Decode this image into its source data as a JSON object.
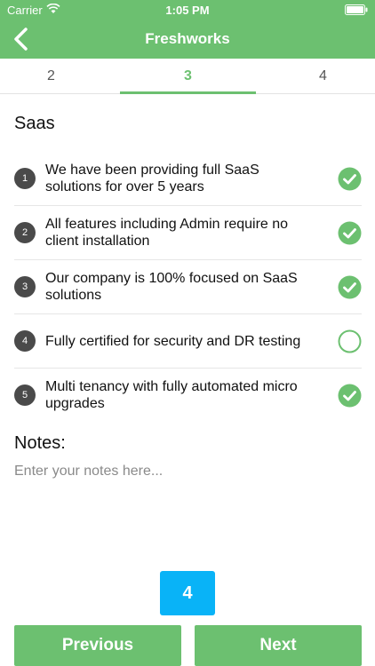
{
  "status_bar": {
    "carrier": "Carrier",
    "time": "1:05 PM"
  },
  "nav": {
    "title": "Freshworks",
    "back_icon": "chevron-left-icon"
  },
  "tabs": [
    {
      "label": "2",
      "active": false
    },
    {
      "label": "3",
      "active": true
    },
    {
      "label": "4",
      "active": false
    }
  ],
  "section": {
    "title": "Saas"
  },
  "checklist": [
    {
      "number": "1",
      "text": "We have been providing full SaaS solutions for over 5 years",
      "checked": true
    },
    {
      "number": "2",
      "text": "All features including Admin require no client installation",
      "checked": true
    },
    {
      "number": "3",
      "text": "Our company is 100% focused on SaaS solutions",
      "checked": true
    },
    {
      "number": "4",
      "text": "Fully certified for security and DR testing",
      "checked": false
    },
    {
      "number": "5",
      "text": "Multi tenancy with fully automated micro upgrades",
      "checked": true
    }
  ],
  "notes": {
    "label": "Notes:",
    "placeholder": "Enter your notes here...",
    "value": ""
  },
  "pagination": {
    "current_page": "4"
  },
  "buttons": {
    "previous": "Previous",
    "next": "Next"
  },
  "colors": {
    "primary": "#6cc070",
    "badge": "#09b3f7",
    "number_bg": "#4a4a4a"
  }
}
